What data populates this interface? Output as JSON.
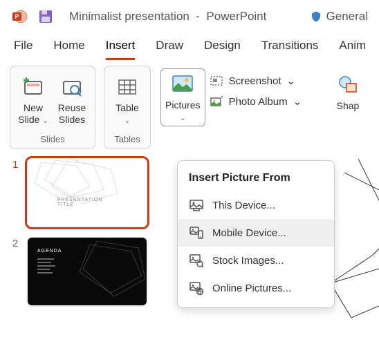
{
  "title_bar": {
    "doc_name": "Minimalist presentation",
    "app_name": "PowerPoint",
    "security_label": "General"
  },
  "menu": {
    "items": [
      "File",
      "Home",
      "Insert",
      "Draw",
      "Design",
      "Transitions",
      "Anim"
    ]
  },
  "ribbon": {
    "new_slide": "New\nSlide",
    "reuse_slides": "Reuse\nSlides",
    "group_slides": "Slides",
    "table": "Table",
    "group_tables": "Tables",
    "pictures": "Pictures",
    "screenshot": "Screenshot",
    "photo_album": "Photo Album",
    "shapes": "Shap"
  },
  "dropdown": {
    "title": "Insert Picture From",
    "items": [
      {
        "label": "This Device...",
        "icon": "device"
      },
      {
        "label": "Mobile Device...",
        "icon": "mobile"
      },
      {
        "label": "Stock Images...",
        "icon": "stock"
      },
      {
        "label": "Online Pictures...",
        "icon": "online"
      }
    ]
  },
  "thumbs": {
    "slide1_title": "PRESENTATION TITLE",
    "slide2_title": "AGENDA",
    "num1": "1",
    "num2": "2"
  }
}
